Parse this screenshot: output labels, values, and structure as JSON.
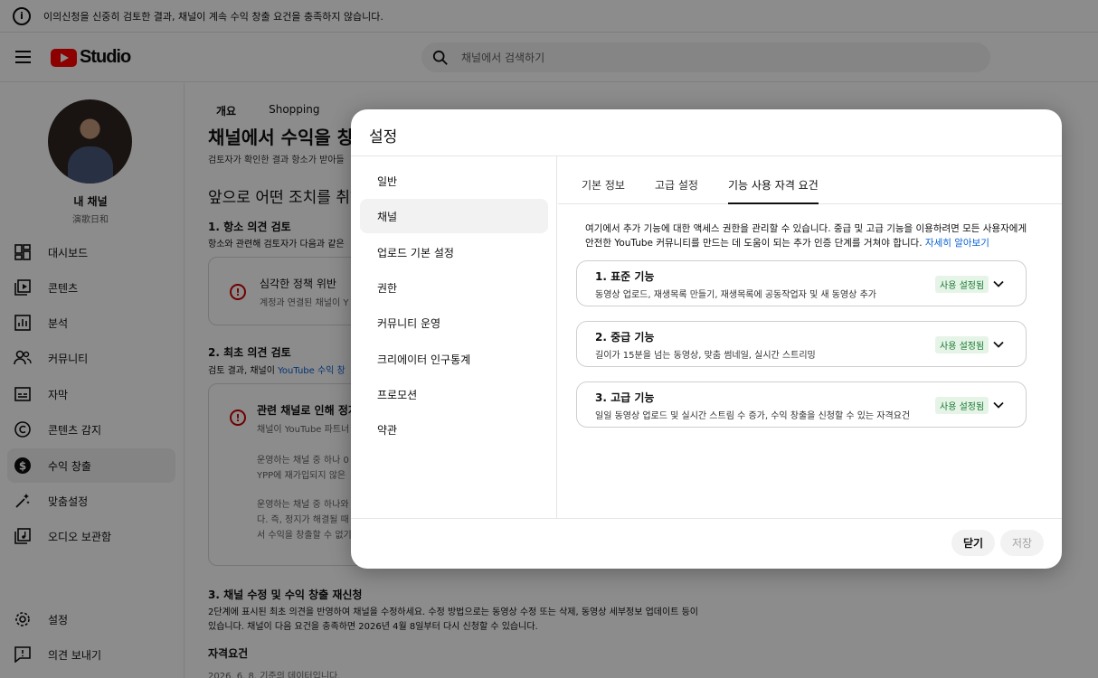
{
  "banner": {
    "text": "이의신청을 신중히 검토한 결과, 채널이 계속 수익 창출 요건을 충족하지 않습니다."
  },
  "header": {
    "logo_text": "Studio",
    "search_placeholder": "채널에서 검색하기"
  },
  "sidebar": {
    "channel_name": "내 채널",
    "channel_handle": "演歌日和",
    "items": [
      {
        "label": "대시보드",
        "icon": "dashboard-icon"
      },
      {
        "label": "콘텐츠",
        "icon": "content-icon"
      },
      {
        "label": "분석",
        "icon": "analytics-icon"
      },
      {
        "label": "커뮤니티",
        "icon": "community-icon"
      },
      {
        "label": "자막",
        "icon": "subtitles-icon"
      },
      {
        "label": "콘텐츠 감지",
        "icon": "copyright-icon"
      },
      {
        "label": "수익 창출",
        "icon": "monetization-icon"
      },
      {
        "label": "맞춤설정",
        "icon": "customization-icon"
      },
      {
        "label": "오디오 보관함",
        "icon": "audio-library-icon"
      }
    ],
    "settings_label": "설정",
    "feedback_label": "의견 보내기"
  },
  "main": {
    "tabs": [
      "개요",
      "Shopping"
    ],
    "title": "채널에서 수익을 창",
    "subtitle": "검토자가 확인한 결과 항소가 받아들",
    "next_steps": "앞으로 어떤 조치를 취하",
    "step1_title": "1. 항소 의견 검토",
    "step1_desc": "항소와 관련해 검토자가 다음과 같은",
    "card1_title": "심각한 정책 위반",
    "card1_desc": "계정과 연결된 채널이 Y",
    "step2_title": "2. 최초 의견 검토",
    "step2_desc_prefix": "검토 결과, 채널이",
    "step2_link": "YouTube 수익 창",
    "card2_title": "관련 채널로 인해 정지",
    "card2_desc": "채널이 YouTube 파트너",
    "card2_p1a": "운영하는 채널 중 하나 0",
    "card2_p1b": "YPP에 재가입되지 않은",
    "card2_p2a": "운영하는 채널 중 하나와",
    "card2_p2b": "다. 즉, 정지가 해결될 때",
    "card2_p2c": "서 수익을 창출할 수 없기",
    "step3_title": "3. 채널 수정 및 수익 창출 재신청",
    "step3_desc1": "2단계에 표시된 최초 의견을 반영하여 채널을 수정하세요. 수정 방법으로는 동영상 수정 또는 삭제, 동영상 세부정보 업데이트 등이",
    "step3_desc2": "있습니다. 채널이 다음 요건을 충족하면 2026년 4월 8일부터 다시 신청할 수 있습니다.",
    "requirements_title": "자격요건",
    "requirements_date": "2026. 6. 8. 기준의 데이터입니다."
  },
  "modal": {
    "title": "설정",
    "menu": [
      "일반",
      "채널",
      "업로드 기본 설정",
      "권한",
      "커뮤니티 운영",
      "크리에이터 인구통계",
      "프로모션",
      "약관"
    ],
    "active_menu": "채널",
    "tabs": [
      "기본 정보",
      "고급 설정",
      "기능 사용 자격 요건"
    ],
    "active_tab": "기능 사용 자격 요건",
    "description": "여기에서 추가 기능에 대한 액세스 권한을 관리할 수 있습니다. 중급 및 고급 기능을 이용하려면 모든 사용자에게 안전한 YouTube 커뮤니티를 만드는 데 도움이 되는 추가 인증 단계를 거쳐야 합니다.",
    "learn_more": "자세히 알아보기",
    "features": [
      {
        "title": "1. 표준 기능",
        "desc": "동영상 업로드, 재생목록 만들기, 재생목록에 공동작업자 및 새 동영상 추가",
        "status": "사용 설정됨"
      },
      {
        "title": "2. 중급 기능",
        "desc": "길이가 15분을 넘는 동영상, 맞춤 썸네일, 실시간 스트리밍",
        "status": "사용 설정됨"
      },
      {
        "title": "3. 고급 기능",
        "desc": "일일 동영상 업로드 및 실시간 스트림 수 증가, 수익 창출을 신청할 수 있는 자격요건",
        "status": "사용 설정됨"
      }
    ],
    "close_label": "닫기",
    "save_label": "저장"
  }
}
